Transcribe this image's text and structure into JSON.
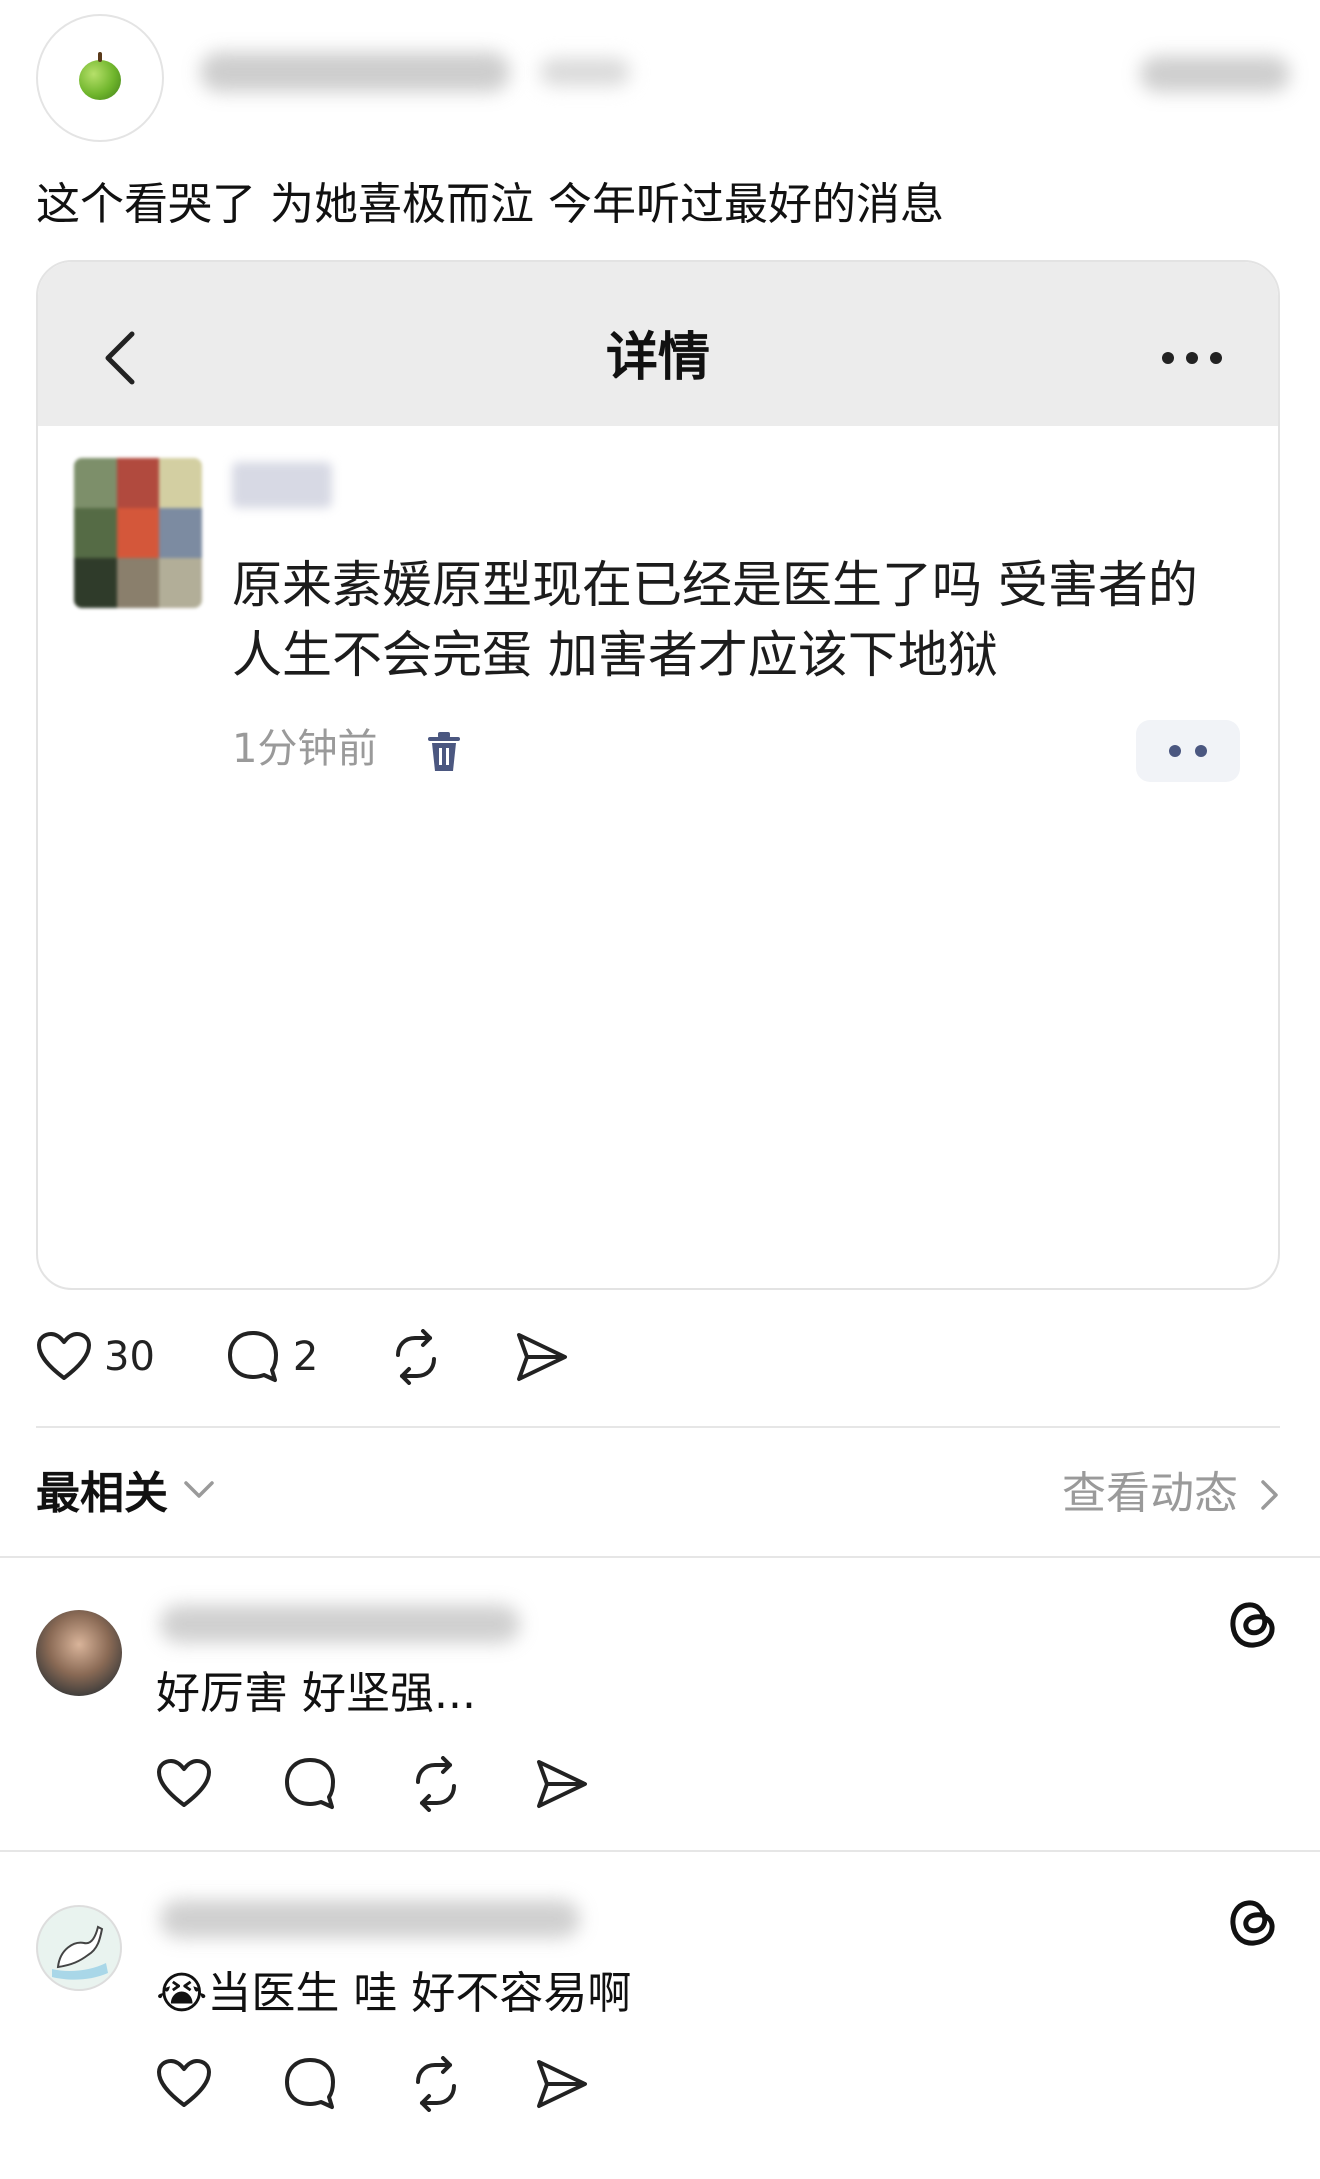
{
  "post": {
    "text": "这个看哭了 为她喜极而泣 今年听过最好的消息"
  },
  "embedded": {
    "title": "详情",
    "comment_text": "原来素媛原型现在已经是医生了吗 受害者的人生不会完蛋 加害者才应该下地狱",
    "timestamp": "1分钟前",
    "mosaic_colors": [
      "#7d8f6a",
      "#b14a3e",
      "#d3cfa2",
      "#556b45",
      "#d4573a",
      "#7c8ba1",
      "#2f3b2a",
      "#8a7f6c",
      "#b2ae98"
    ]
  },
  "actions": {
    "likes": "30",
    "replies": "2"
  },
  "sort": {
    "label": "最相关",
    "view_activity": "查看动态"
  },
  "replies": [
    {
      "text": "好厉害 好坚强..."
    },
    {
      "emoji": "😭",
      "text": "当医生 哇  好不容易啊"
    }
  ],
  "colors": {
    "icon": "#222222",
    "muted": "#9a9a9a",
    "trash": "#4b5780"
  }
}
